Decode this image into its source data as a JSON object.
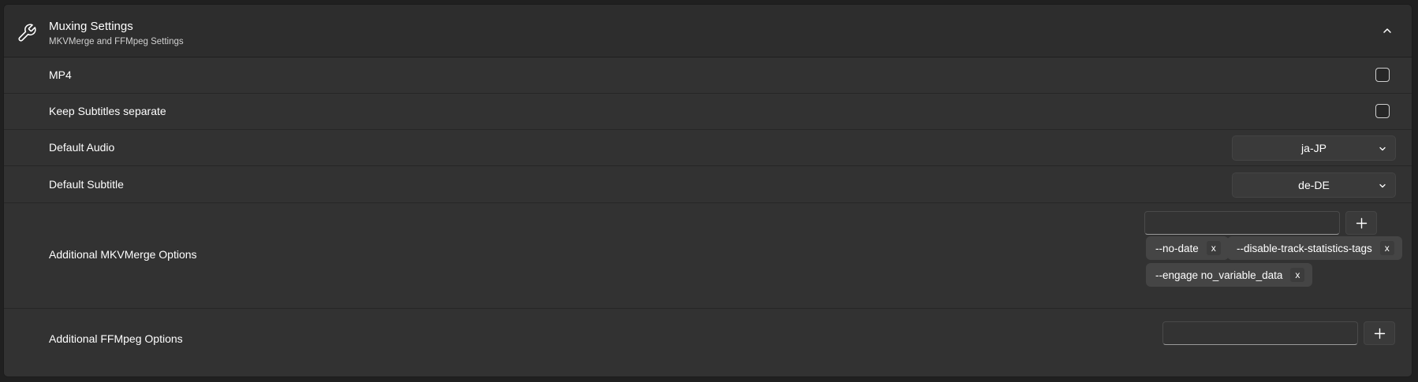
{
  "section": {
    "title": "Muxing Settings",
    "subtitle": "MKVMerge and FFMpeg Settings",
    "icon": "wrench-icon",
    "expanded": true
  },
  "rows": {
    "mp4": {
      "label": "MP4",
      "checked": false
    },
    "keep_subtitles": {
      "label": "Keep Subtitles separate",
      "checked": false
    },
    "default_audio": {
      "label": "Default Audio",
      "value": "ja-JP"
    },
    "default_subtitle": {
      "label": "Default Subtitle",
      "value": "de-DE"
    },
    "mkvmerge_options": {
      "label": "Additional MKVMerge Options",
      "input_value": "",
      "tags": [
        "--no-date",
        "--disable-track-statistics-tags",
        "--engage no_variable_data"
      ],
      "remove_label": "x"
    },
    "ffmpeg_options": {
      "label": "Additional FFMpeg Options",
      "input_value": ""
    }
  }
}
